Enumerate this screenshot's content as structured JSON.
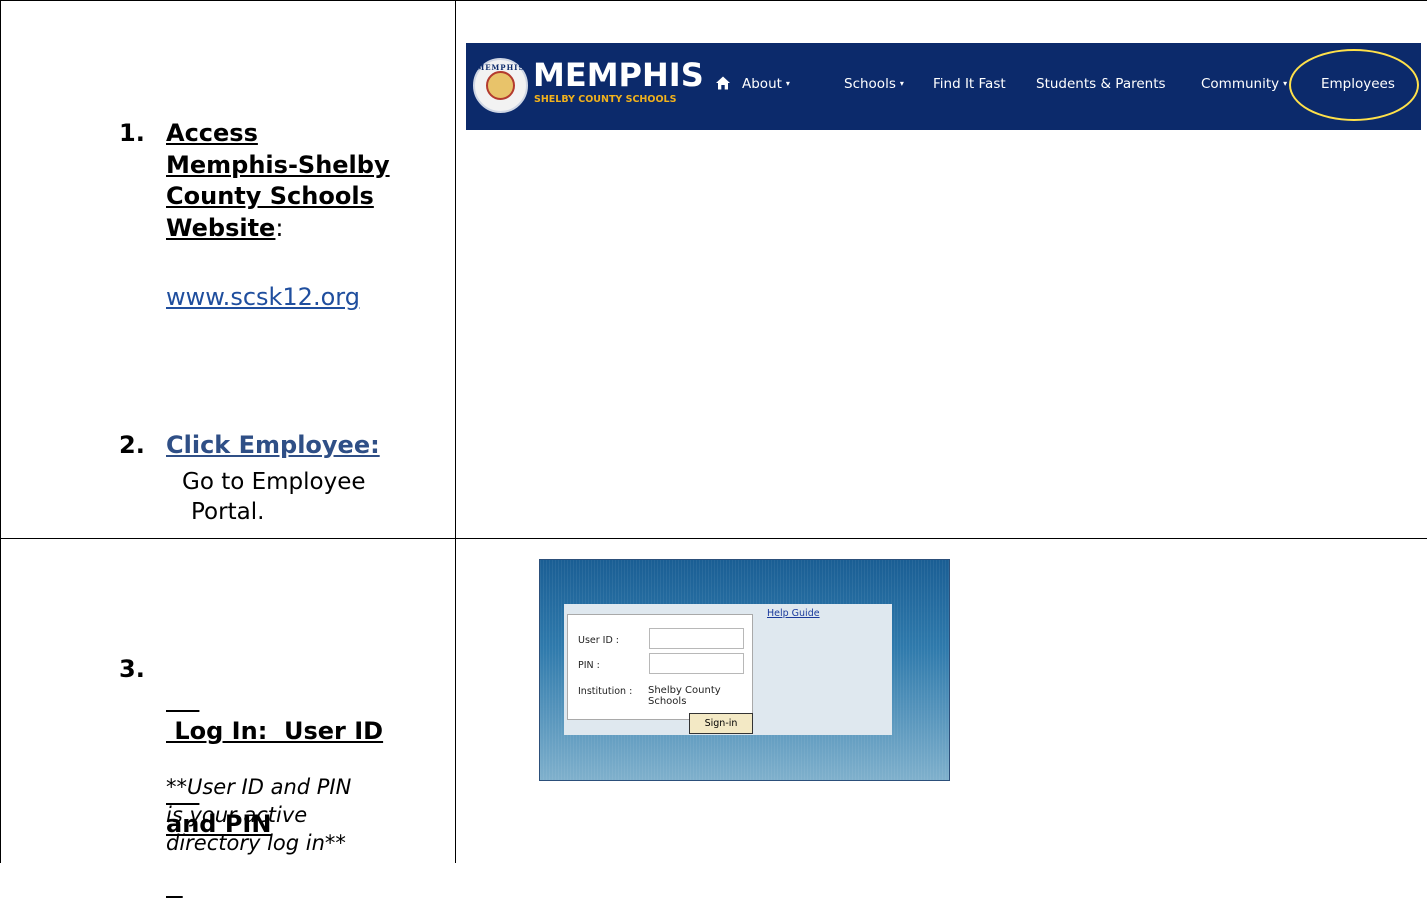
{
  "steps": {
    "s1": {
      "number": "1.",
      "title_lines": [
        "Access",
        "Memphis-Shelby",
        "County Schools",
        "Website"
      ],
      "colon": ":",
      "link": "www.scsk12.org"
    },
    "s2": {
      "number": "2.",
      "title": "Click Employee:",
      "desc_line1": "Go to Employee",
      "desc_line2": "Portal."
    },
    "s3": {
      "number": "3.",
      "title_line1": " Log In:  User ID",
      "title_line2": "and PIN",
      "note_lines": [
        "**User ID and PIN",
        "is your active",
        "directory log in**"
      ]
    }
  },
  "navbar": {
    "brand": "MEMPHIS",
    "brand_sub": "SHELBY COUNTY SCHOOLS",
    "seal_text": "MEMPHIS",
    "items": [
      {
        "label": "About",
        "dropdown": "▾"
      },
      {
        "label": "Schools",
        "dropdown": "▾"
      },
      {
        "label": "Find It Fast"
      },
      {
        "label": "Students & Parents"
      },
      {
        "label": "Community",
        "dropdown": "▾"
      },
      {
        "label": "Employees"
      }
    ],
    "colors": {
      "bar": "#0c2a6b",
      "highlight": "#ffe14a",
      "brand_sub": "#f2b21c"
    }
  },
  "login": {
    "help_link": "Help Guide",
    "user_id_label": "User ID :",
    "pin_label": "PIN :",
    "institution_label": "Institution :",
    "institution_value": "Shelby County Schools",
    "signin_label": "Sign-in"
  },
  "colors": {
    "link": "#1f4e9e",
    "step2_title": "#2f4f86"
  }
}
